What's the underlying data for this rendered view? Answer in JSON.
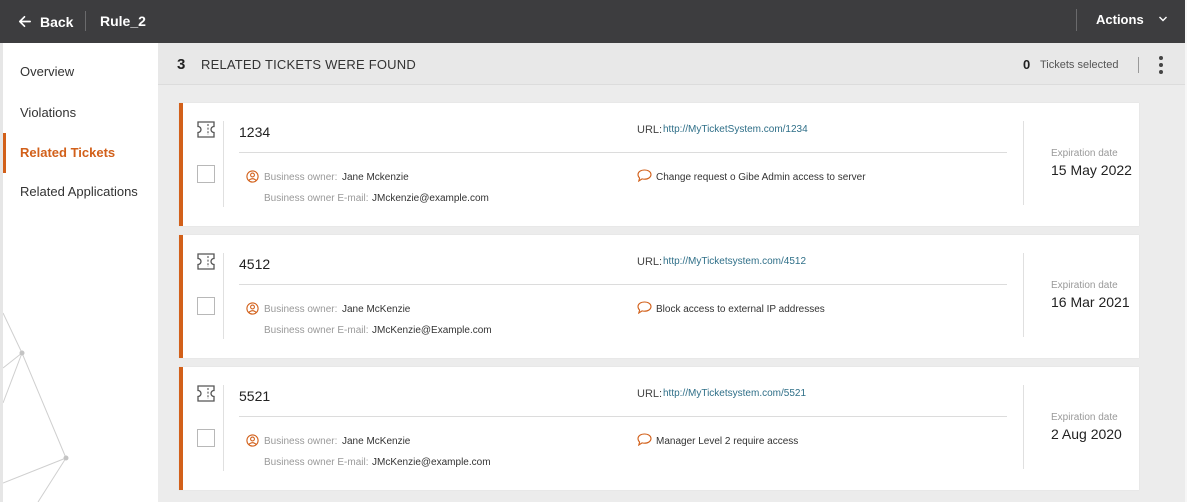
{
  "topbar": {
    "back_label": "Back",
    "title": "Rule_2",
    "actions_label": "Actions"
  },
  "sidebar": {
    "items": [
      {
        "label": "Overview",
        "active": false
      },
      {
        "label": "Violations",
        "active": false
      },
      {
        "label": "Related Tickets",
        "active": true
      },
      {
        "label": "Related Applications",
        "active": false
      }
    ]
  },
  "results": {
    "count": "3",
    "label": "RELATED TICKETS WERE FOUND",
    "selected_count": "0",
    "selected_label": "Tickets selected"
  },
  "tickets": [
    {
      "id": "1234",
      "url_label": "URL:",
      "url": "http://MyTicketSystem.com/1234",
      "owner_label": "Business owner:",
      "owner": "Jane Mckenzie",
      "email_label": "Business owner E-mail:",
      "email": "JMckenzie@example.com",
      "description": "Change request o Gibe Admin access to server",
      "exp_label": "Expiration date",
      "exp_date": "15 May 2022"
    },
    {
      "id": "4512",
      "url_label": "URL:",
      "url": "http://MyTicketsystem.com/4512",
      "owner_label": "Business owner:",
      "owner": "Jane McKenzie",
      "email_label": "Business owner E-mail:",
      "email": "JMcKenzie@Example.com",
      "description": "Block access to external IP addresses",
      "exp_label": "Expiration date",
      "exp_date": "16 Mar 2021"
    },
    {
      "id": "5521",
      "url_label": "URL:",
      "url": "http://MyTicketsystem.com/5521",
      "owner_label": "Business owner:",
      "owner": "Jane McKenzie",
      "email_label": "Business owner E-mail:",
      "email": "JMcKenzie@example.com",
      "description": "Manager Level 2 require access",
      "exp_label": "Expiration date",
      "exp_date": "2 Aug 2020"
    }
  ],
  "colors": {
    "accent": "#d2601a",
    "topbar": "#3d3d3f",
    "link": "#2f6f88"
  },
  "icons": {
    "back": "arrow-left-icon",
    "actions": "chevron-down-icon",
    "more": "kebab-menu-icon",
    "ticket": "ticket-icon",
    "owner": "user-circle-icon",
    "description": "comment-icon"
  }
}
